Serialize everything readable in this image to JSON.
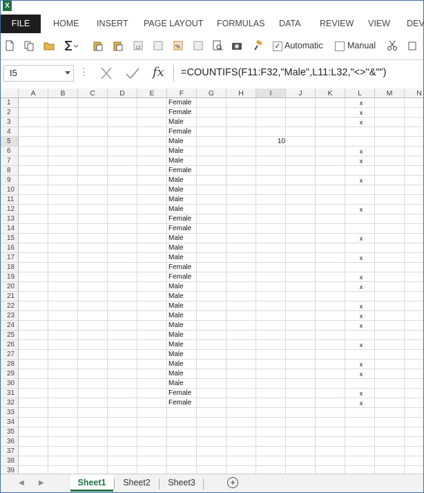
{
  "app": {
    "logo_text": "X",
    "accent": "#217346"
  },
  "ribbon": {
    "tabs": [
      "FILE",
      "HOME",
      "INSERT",
      "PAGE LAYOUT",
      "FORMULAS",
      "DATA",
      "REVIEW",
      "VIEW",
      "DEVE"
    ]
  },
  "toolbar": {
    "automatic_label": "Automatic",
    "automatic_checked": true,
    "manual_label": "Manual",
    "manual_checked": false
  },
  "formula_bar": {
    "name_box": "I5",
    "fx_label": "fx",
    "formula": "=COUNTIFS(F11:F32,\"Male\",L11:L32,\"<>\"&\"\")"
  },
  "grid": {
    "columns": [
      "A",
      "B",
      "C",
      "D",
      "E",
      "F",
      "G",
      "H",
      "I",
      "J",
      "K",
      "L",
      "M",
      "N"
    ],
    "rows": [
      "1",
      "2",
      "3",
      "4",
      "5",
      "6",
      "7",
      "8",
      "9",
      "10",
      "11",
      "12",
      "13",
      "14",
      "15",
      "16",
      "17",
      "18",
      "19",
      "20",
      "21",
      "22",
      "23",
      "24",
      "25",
      "26",
      "27",
      "28",
      "29",
      "30",
      "31",
      "32",
      "33",
      "34",
      "35",
      "36",
      "37",
      "38",
      "39"
    ],
    "column_f": [
      "Female",
      "Female",
      "Male",
      "Female",
      "Male",
      "Male",
      "Male",
      "Female",
      "Male",
      "Male",
      "Male",
      "Male",
      "Female",
      "Female",
      "Male",
      "Male",
      "Male",
      "Female",
      "Female",
      "Male",
      "Male",
      "Male",
      "Male",
      "Male",
      "Male",
      "Male",
      "Male",
      "Male",
      "Male",
      "Male",
      "Female",
      "Female"
    ],
    "column_l": [
      "x",
      "x",
      "x",
      "",
      "",
      "x",
      "x",
      "",
      "x",
      "",
      "",
      "x",
      "",
      "",
      "x",
      "",
      "x",
      "",
      "x",
      "x",
      "",
      "x",
      "x",
      "x",
      "",
      "x",
      "",
      "x",
      "x",
      "",
      "x",
      "x"
    ],
    "i5_value": "10"
  },
  "sheets": {
    "tabs": [
      "Sheet1",
      "Sheet2",
      "Sheet3"
    ],
    "active": "Sheet1",
    "add_label": "+"
  }
}
